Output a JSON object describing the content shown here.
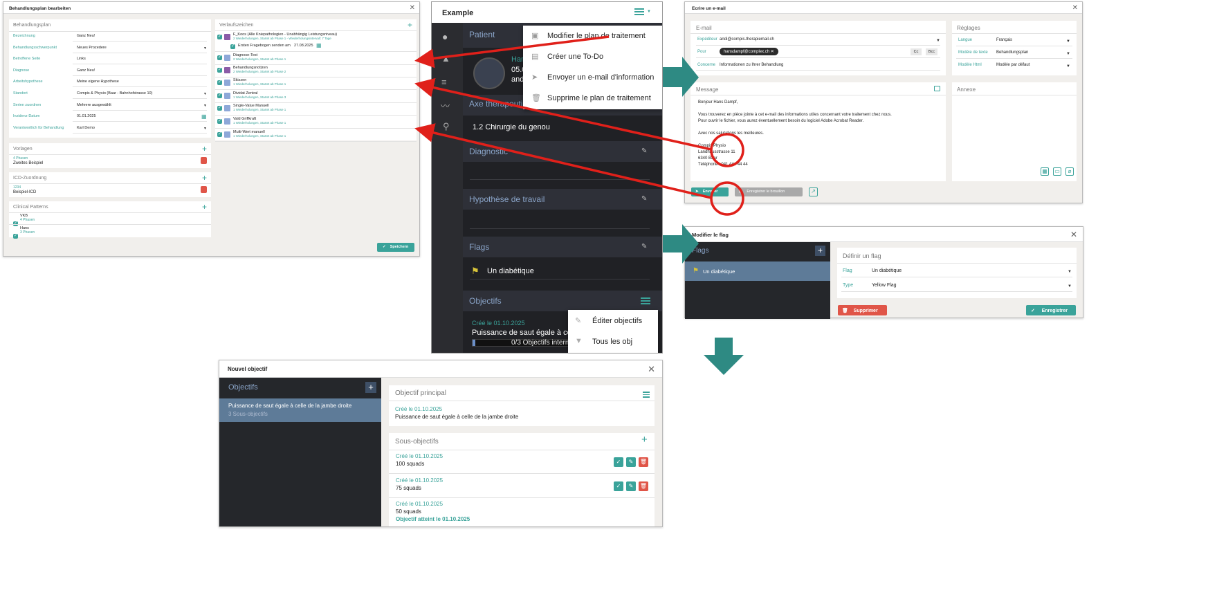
{
  "plan": {
    "title": "Behandlungsplan bearbeiten",
    "left_header": "Behandlungsplan",
    "fields": [
      {
        "label": "Bezeichnung",
        "value": "Ganz Neu!"
      },
      {
        "label": "Behandlungsschwerpunkt",
        "value": "Neues Prozedere"
      },
      {
        "label": "Betroffene Seite",
        "value": "Links"
      },
      {
        "label": "Diagnose",
        "value": "Ganz Neu!"
      },
      {
        "label": "Arbeitshypothese",
        "value": "Meine eigene Hypothese"
      },
      {
        "label": "Standort",
        "value": "Compis & Physio (Baar - Bahnhofstrasse 10)"
      },
      {
        "label": "Serien zuordnen",
        "value": "Mehrere ausgewählt"
      },
      {
        "label": "Inzidenz-Datum",
        "value": "01.01.2025"
      },
      {
        "label": "Verantwortlich für Behandlung",
        "value": "Karl Demo"
      }
    ],
    "vorlagen": {
      "header": "Vorlagen",
      "sub": "4 Phasen",
      "name": "Zweites Beispiel"
    },
    "icd": {
      "header": "ICD-Zuordnung",
      "sub": "1234",
      "name": "Beispiel-ICD"
    },
    "clinical": {
      "header": "Clinical Patterns",
      "items": [
        {
          "name": "VKB",
          "sub": "4 Phasen"
        },
        {
          "name": "Hans",
          "sub": "3 Phasen"
        }
      ]
    },
    "verlauf": {
      "header": "Verlaufszeichen",
      "items": [
        {
          "name": "F_Koos (Alle Kniepathologien - Unabhängig Leistungsniveau)",
          "sub": "2 Wiederholungen, Startet ab Phase 1 - Wiederholungsintervall: 7 Tage"
        },
        {
          "name": "Diagnose-Test",
          "sub": "2 Wiederholungen, Startet ab Phase 1"
        },
        {
          "name": "Behandlungsnotizen",
          "sub": "2 Wiederholungen, Startet ab Phase 2"
        },
        {
          "name": "Skizzen",
          "sub": "1 Wiederholungen, Startet ab Phase 1"
        },
        {
          "name": "Dividat Zentral",
          "sub": "1 Wiederholungen, Startet ab Phase 3"
        },
        {
          "name": "Single-Value Manuell",
          "sub": "1 Wiederholungen, Startet ab Phase 1"
        },
        {
          "name": "Vald Griffkraft",
          "sub": "1 Wiederholungen, Startet ab Phase 1"
        },
        {
          "name": "Multi-Wert manuell",
          "sub": "1 Wiederholungen, Startet ab Phase 1"
        }
      ],
      "first_send_label": "Ersten Fragebogen senden am",
      "first_send_date": "27.08.2025"
    },
    "save": "Speichern"
  },
  "app": {
    "title": "Example",
    "patient": "Patient",
    "patient_name": "Han",
    "patient_line2": "05.0",
    "patient_line3": "and",
    "axe": "Axe thérapeuti",
    "axe_value": "1.2 Chirurgie du genou",
    "diagnostic": "Diagnostic",
    "hypothese": "Hypothèse de travail",
    "flags": "Flags",
    "flag_value": "Un diabétique",
    "objectifs": "Objectifs",
    "obj_created": "Créé le 01.10.2025",
    "obj_title": "Puissance de saut égale à celle",
    "obj_progress": "0/3 Objectifs interm",
    "menu": [
      "Modifier le plan de traitement",
      "Créer une To-Do",
      "Envoyer un e-mail d'information",
      "Supprime le plan de traitement"
    ],
    "obj_menu": [
      "Éditer objectifs",
      "Tous les obj"
    ]
  },
  "email": {
    "title": "Ecrire un e-mail",
    "email_header": "E-mail",
    "from_label": "Expéditeur",
    "from_value": "andi@compis.therapiemail.ch",
    "to_label": "Pour",
    "to_value": "hansdampf@complex.ch",
    "cc": "Cc",
    "bcc": "Bcc",
    "subject_label": "Concerne",
    "subject_value": "Informationen zu Ihrer Behandlung",
    "settings_header": "Réglages",
    "lang_label": "Langue",
    "lang_value": "Français",
    "tpl_label": "Modèle de texte",
    "tpl_value": "Behandlungsplan",
    "html_label": "Modèle Html",
    "html_value": "Modèle par défaut",
    "message_header": "Message",
    "annex_header": "Annexe",
    "message_lines": [
      "Bonjour Hans Dampf,",
      "",
      "Vous trouverez en pièce jointe à cet e-mail des informations utiles concernant votre traitement chez nous.",
      "Pour ouvrir le fichier, vous aurez éventuellement besoin du logiciel Adobe Acrobat Reader.",
      "",
      "Avec nos salutations les meilleures.",
      "",
      "Compis Physio",
      "Landhausstrasse 11",
      "6340 Baar",
      "Téléphone : 041 444 44 44"
    ],
    "send": "Envoyer",
    "draft": "Enregistrer le brouillon"
  },
  "flag": {
    "title": "Modifier le flag",
    "list_header": "Flags",
    "item": "Un diabétique",
    "form_header": "Définir un flag",
    "flag_label": "Flag",
    "flag_value": "Un diabétique",
    "type_label": "Type",
    "type_value": "Yellow Flag",
    "delete": "Supprimer",
    "save": "Enregistrer"
  },
  "objective": {
    "title": "Nouvel objectif",
    "list_header": "Objectifs",
    "item_title": "Puissance de saut égale à celle de la jambe droite",
    "item_sub": "3 Sous-objectifs",
    "main_header": "Objectif principal",
    "main_created": "Créé le 01.10.2025",
    "main_text": "Puissance de saut égale à celle de la jambe droite",
    "sub_header": "Sous-objectifs",
    "subs": [
      {
        "created": "Créé le 01.10.2025",
        "text": "100 squads"
      },
      {
        "created": "Créé le 01.10.2025",
        "text": "75 squads"
      },
      {
        "created": "Créé le 01.10.2025",
        "text": "50 squads",
        "done": "Objectif atteint le 01.10.2025"
      }
    ]
  }
}
